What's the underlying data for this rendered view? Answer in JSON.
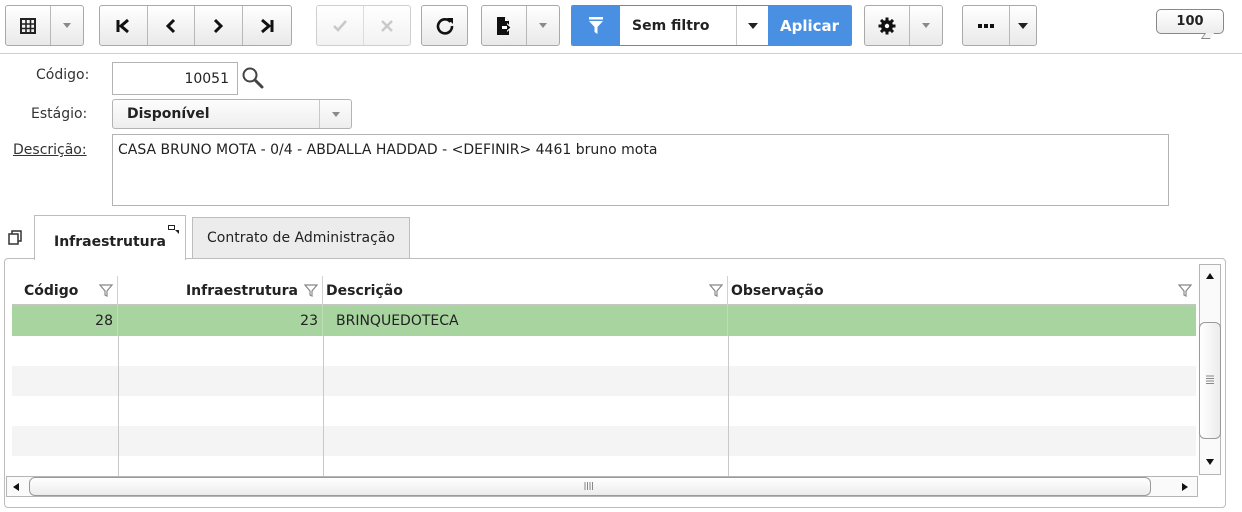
{
  "toolbar": {
    "grid_view_icon": "grid-icon",
    "nav": [
      "first-record-icon",
      "previous-record-icon",
      "next-record-icon",
      "last-record-icon"
    ],
    "confirm_icon": "check-icon",
    "cancel_icon": "close-icon",
    "refresh_icon": "refresh-icon",
    "export_icon": "export-document-icon",
    "filter": {
      "icon": "funnel-icon",
      "selected": "Sem filtro",
      "apply_label": "Aplicar",
      "accent": "#4a90e2"
    },
    "settings_icon": "gear-icon",
    "more_icon": "ellipsis-icon",
    "record_count": "100"
  },
  "form": {
    "code_label": "Código:",
    "code_value": "10051",
    "stage_label": "Estágio:",
    "stage_value": "Disponível",
    "description_label": "Descrição:",
    "description_value": "CASA BRUNO MOTA - 0/4 - ABDALLA HADDAD - <DEFINIR> 4461 bruno mota"
  },
  "tabs": [
    {
      "label": "Infraestrutura",
      "active": true
    },
    {
      "label": "Contrato de Administração",
      "active": false
    }
  ],
  "grid": {
    "columns": [
      "Código",
      "Infraestrutura",
      "Descrição",
      "Observação"
    ],
    "rows": [
      {
        "codigo": "28",
        "infraestrutura": "23",
        "descricao": "BRINQUEDOTECA",
        "observacao": ""
      }
    ],
    "selected_row_color": "#a8d4a0"
  }
}
